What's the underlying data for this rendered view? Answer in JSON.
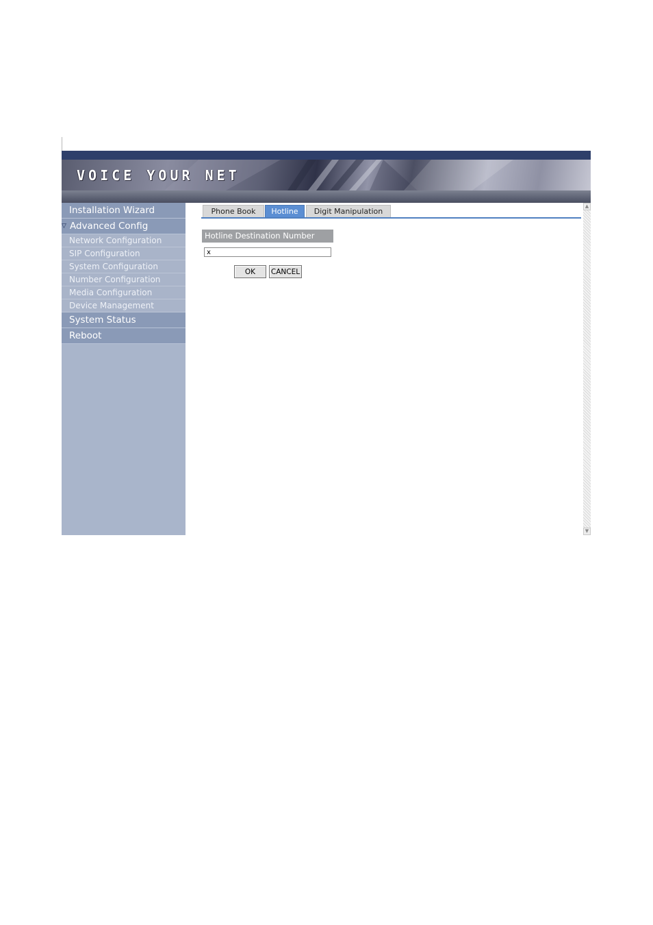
{
  "banner": {
    "logo": "VOICE YOUR NET"
  },
  "sidebar": {
    "top_items": [
      {
        "label": "Installation Wizard"
      },
      {
        "label": "Advanced Config",
        "expanded": true
      }
    ],
    "sub_items": [
      {
        "label": "Network Configuration"
      },
      {
        "label": "SIP Configuration"
      },
      {
        "label": "System Configuration"
      },
      {
        "label": "Number Configuration"
      },
      {
        "label": "Media Configuration"
      },
      {
        "label": "Device Management"
      }
    ],
    "bottom_items": [
      {
        "label": "System Status"
      },
      {
        "label": "Reboot"
      }
    ]
  },
  "tabs": [
    {
      "label": "Phone Book",
      "active": false
    },
    {
      "label": "Hotline",
      "active": true
    },
    {
      "label": "Digit Manipulation",
      "active": false
    }
  ],
  "form": {
    "field_label": "Hotline Destination Number",
    "field_value": "x",
    "ok_label": "OK",
    "cancel_label": "CANCEL"
  },
  "colors": {
    "sidebar_main": "#8a9ab7",
    "sidebar_bg": "#a9b5cb",
    "active_tab": "#5b8ed3",
    "tab_underline": "#4f7fc0",
    "banner_top": "#2e3f6a"
  },
  "icons": {
    "expand": "triangle-down-icon",
    "scroll_up": "arrow-up-icon",
    "scroll_down": "arrow-down-icon"
  }
}
